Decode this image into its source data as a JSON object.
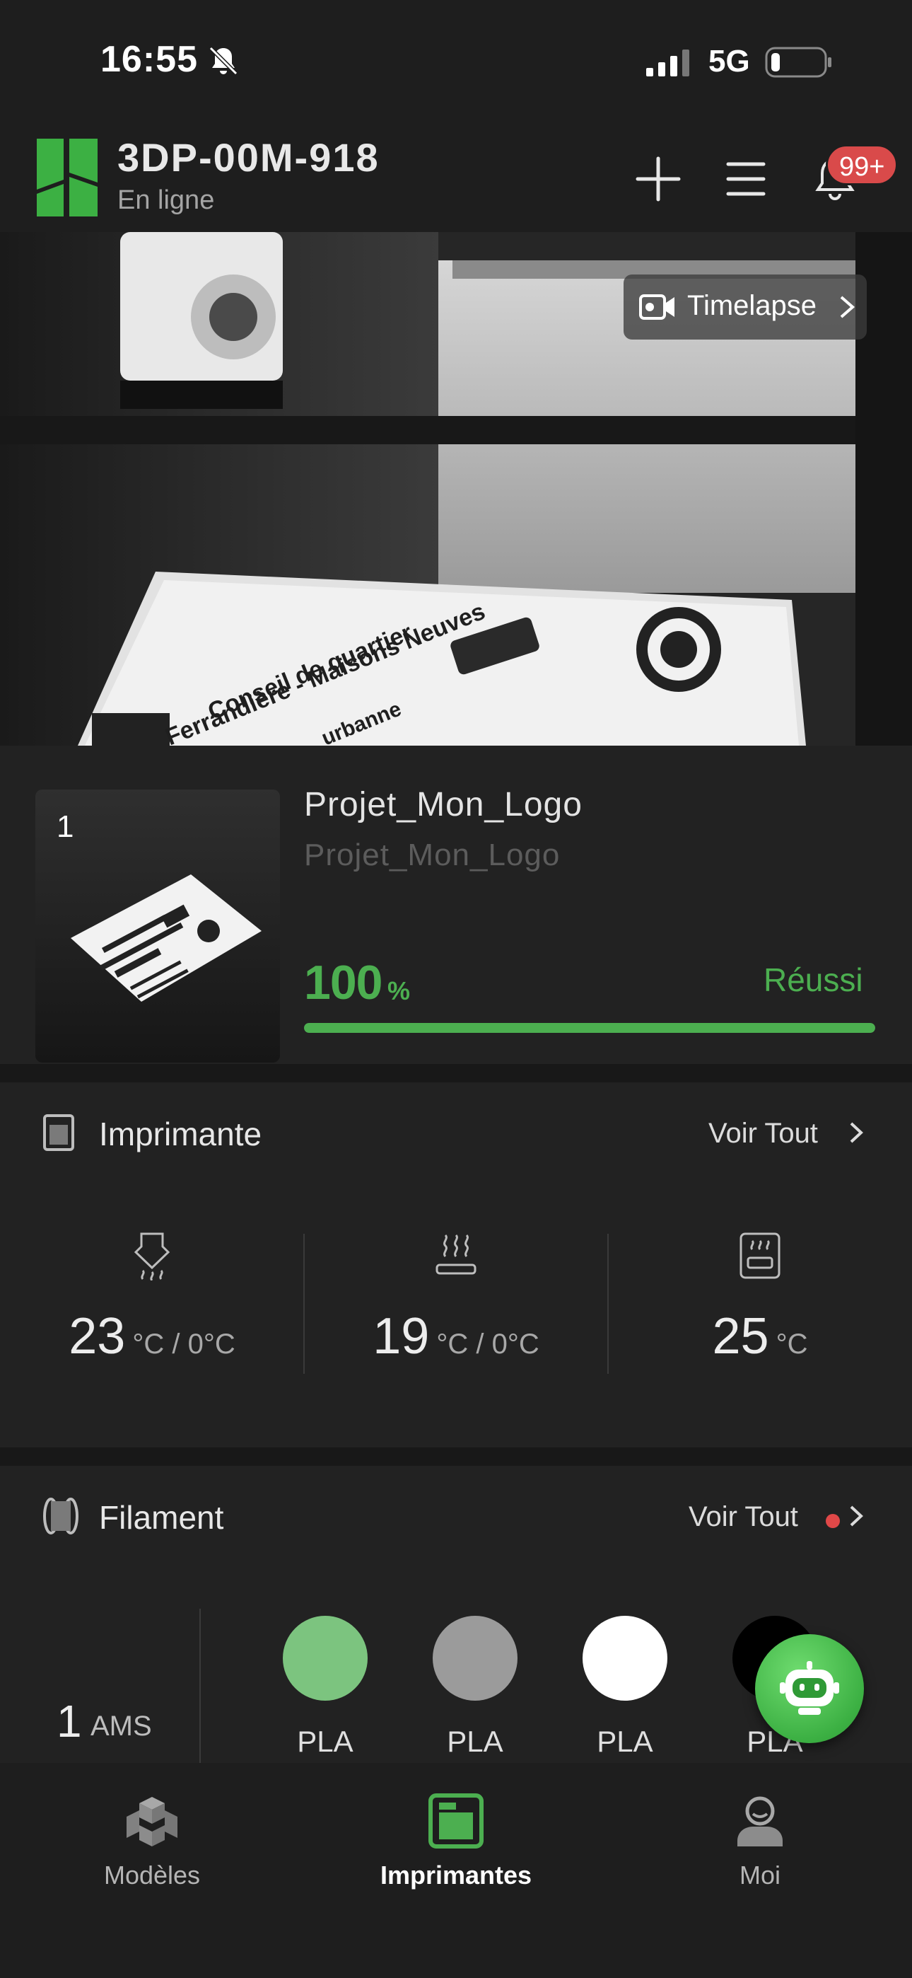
{
  "status_bar": {
    "time": "16:55",
    "network": "5G"
  },
  "header": {
    "device_name": "3DP-00M-918",
    "device_status": "En ligne",
    "notification_badge": "99+",
    "brand_color": "#3cb043"
  },
  "camera": {
    "timelapse_label": "Timelapse"
  },
  "print_job": {
    "plate_number": "1",
    "title": "Projet_Mon_Logo",
    "subtitle": "Projet_Mon_Logo",
    "progress_percent": 100,
    "progress_text": "100",
    "progress_unit": "%",
    "state": "Réussi",
    "accent_color": "#4caf50"
  },
  "printer": {
    "title": "Imprimante",
    "see_all": "Voir Tout",
    "temps": [
      {
        "icon": "nozzle-icon",
        "value": "23",
        "unit": "°C / 0°C"
      },
      {
        "icon": "heatbed-icon",
        "value": "19",
        "unit": "°C / 0°C"
      },
      {
        "icon": "chamber-icon",
        "value": "25",
        "unit": "°C"
      }
    ]
  },
  "filament": {
    "title": "Filament",
    "see_all": "Voir Tout",
    "ams_count": "1",
    "ams_label": "AMS",
    "slots": [
      {
        "color": "#7cc47f",
        "label": "PLA"
      },
      {
        "color": "#9b9b9b",
        "label": "PLA"
      },
      {
        "color": "#ffffff",
        "label": "PLA"
      },
      {
        "color": "#000000",
        "label": "PLA"
      }
    ]
  },
  "bottom_nav": {
    "items": [
      {
        "label": "Modèles",
        "icon": "models-icon",
        "active": false
      },
      {
        "label": "Imprimantes",
        "icon": "printer-nav-icon",
        "active": true
      },
      {
        "label": "Moi",
        "icon": "profile-icon",
        "active": false
      }
    ]
  }
}
